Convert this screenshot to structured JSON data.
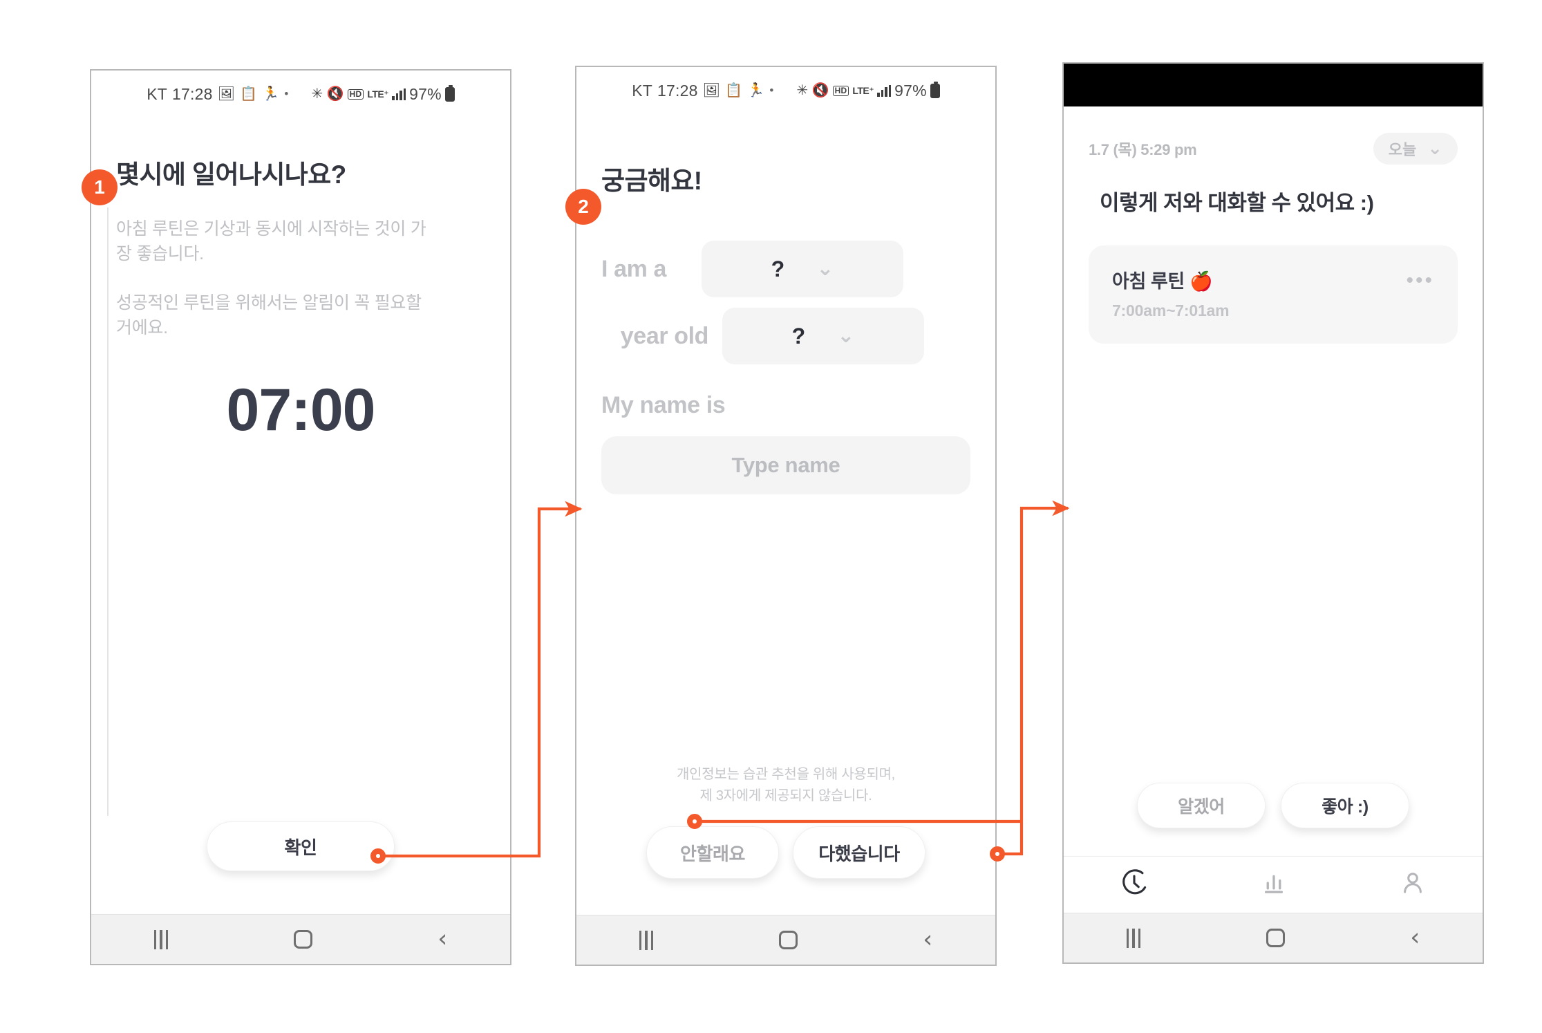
{
  "accent_color": "#f4592b",
  "status_bar": {
    "carrier": "KT",
    "time": "17:28",
    "battery": "97%",
    "icons": [
      "image-icon",
      "clipboard-icon",
      "running-icon",
      "dot-icon",
      "bluetooth-icon",
      "mute-icon",
      "hd-icon",
      "lte-plus-icon",
      "signal-icon",
      "battery-icon"
    ],
    "lte_label": "HD",
    "lte_plus_label": "LTE⁺"
  },
  "nav_bar": {
    "recents_label": "recents-icon",
    "home_label": "home-icon",
    "back_label": "back-icon"
  },
  "screen1": {
    "badge": "1",
    "title": "몇시에 일어나시나요?",
    "paragraph1": "아침 루틴은 기상과 동시에 시작하는 것이 가장 좋습니다.",
    "paragraph2": "성공적인 루틴을 위해서는 알림이 꼭 필요할 거에요.",
    "time_value": "07:00",
    "confirm_button": "확인"
  },
  "screen2": {
    "badge": "2",
    "title": "궁금해요!",
    "field_gender_label": "I am a",
    "field_gender_value": "?",
    "field_age_label": "year old",
    "field_age_value": "?",
    "field_name_label": "My name is",
    "field_name_placeholder": "Type name",
    "disclaimer_line1": "개인정보는 습관 추천을 위해 사용되며,",
    "disclaimer_line2": "제 3자에게 제공되지 않습니다.",
    "cancel_button": "안할래요",
    "submit_button": "다했습니다"
  },
  "screen3": {
    "date_label": "1.7 (목) 5:29 pm",
    "filter_chip": "오늘",
    "title": "이렇게 저와 대화할 수 있어요 :)",
    "card": {
      "name": "아침 루틴 🍎",
      "time_range": "7:00am~7:01am",
      "more_label": "•••"
    },
    "secondary_button": "알겠어",
    "primary_button": "좋아 :)",
    "tabs": [
      {
        "id": "tab-timer",
        "icon": "clock-icon",
        "active": true
      },
      {
        "id": "tab-stats",
        "icon": "bar-chart-icon",
        "active": false
      },
      {
        "id": "tab-profile",
        "icon": "person-icon",
        "active": false
      }
    ]
  }
}
